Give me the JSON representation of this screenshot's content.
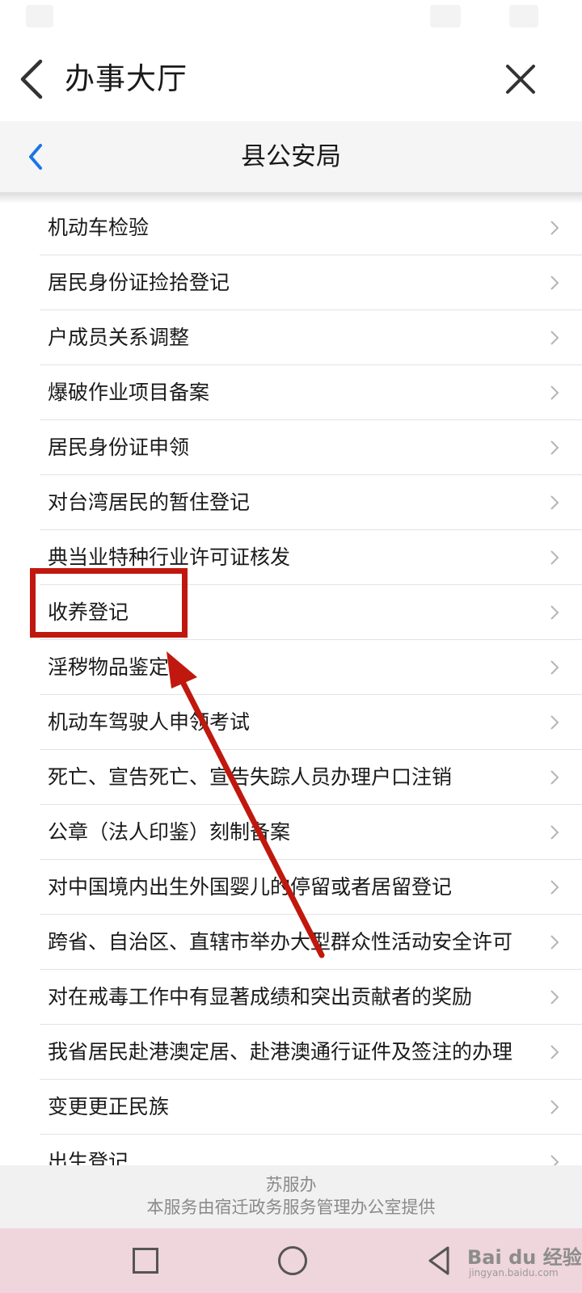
{
  "header": {
    "title": "办事大厅"
  },
  "subheader": {
    "title": "县公安局"
  },
  "services": [
    {
      "label": "机动车检验"
    },
    {
      "label": "居民身份证捡拾登记"
    },
    {
      "label": "户成员关系调整"
    },
    {
      "label": "爆破作业项目备案"
    },
    {
      "label": "居民身份证申领"
    },
    {
      "label": "对台湾居民的暂住登记"
    },
    {
      "label": "典当业特种行业许可证核发"
    },
    {
      "label": "收养登记"
    },
    {
      "label": "淫秽物品鉴定"
    },
    {
      "label": "机动车驾驶人申领考试"
    },
    {
      "label": "死亡、宣告死亡、宣告失踪人员办理户口注销"
    },
    {
      "label": "公章（法人印鉴）刻制备案"
    },
    {
      "label": "对中国境内出生外国婴儿的停留或者居留登记"
    },
    {
      "label": "跨省、自治区、直辖市举办大型群众性活动安全许可"
    },
    {
      "label": "对在戒毒工作中有显著成绩和突出贡献者的奖励"
    },
    {
      "label": "我省居民赴港澳定居、赴港澳通行证件及签注的办理"
    },
    {
      "label": "变更更正民族"
    },
    {
      "label": "出生登记"
    }
  ],
  "annotation": {
    "highlight_color": "#c0180e"
  },
  "footer": {
    "brand": "苏服办",
    "provider": "本服务由宿迁政务服务管理办公室提供"
  },
  "watermark": {
    "text": "Bai du 经验",
    "sub": "jingyan.baidu.com"
  },
  "icons": [
    "back-arrow-icon",
    "close-icon",
    "chevron-left-icon",
    "chevron-right-icon",
    "square-icon",
    "circle-icon",
    "triangle-back-icon"
  ],
  "colors": {
    "accent": "#1a73e8",
    "text": "#1a1a1a",
    "muted": "#8a8a8a",
    "annotation": "#c0180e"
  }
}
